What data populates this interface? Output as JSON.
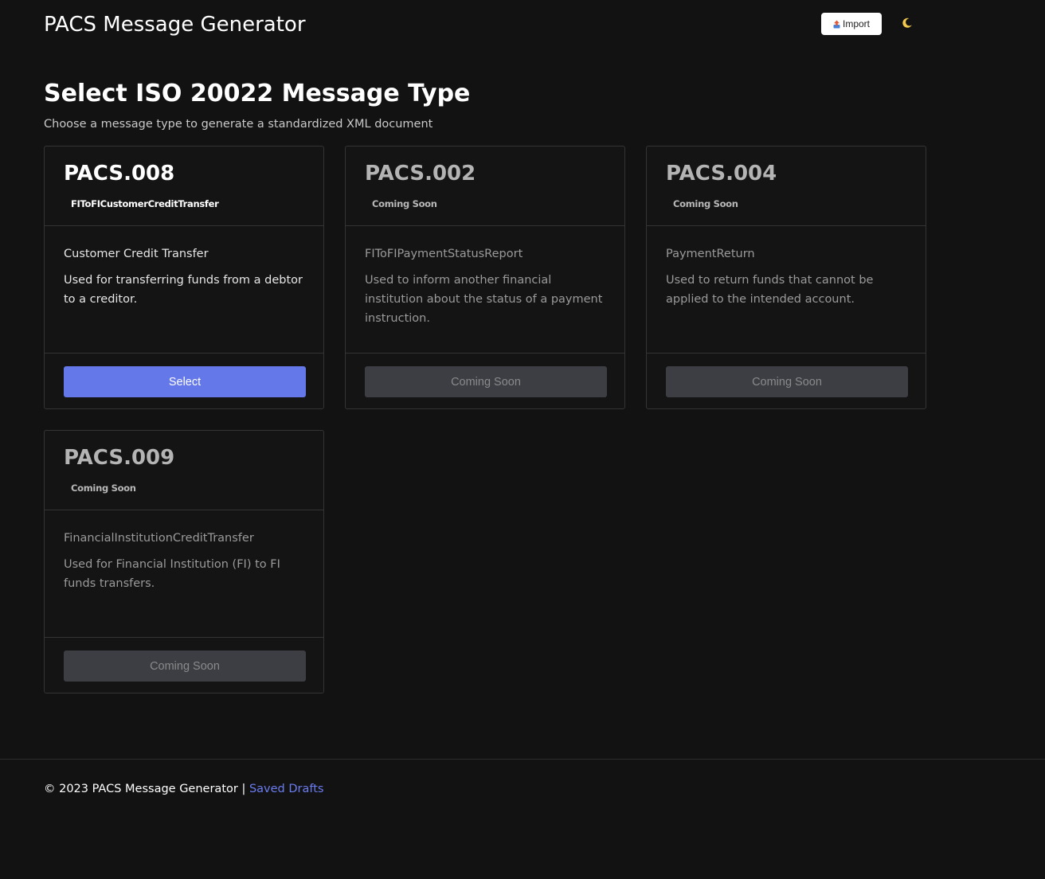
{
  "header": {
    "title": "PACS Message Generator",
    "import_label": "Import",
    "import_icon": "upload-icon",
    "theme_icon": "crescent-moon-icon",
    "theme_icon_color": "#f2c94c"
  },
  "main": {
    "heading": "Select ISO 20022 Message Type",
    "subheading": "Choose a message type to generate a standardized XML document",
    "cards": [
      {
        "code": "PACS.008",
        "badge": "FIToFICustomerCreditTransfer",
        "name": "Customer Credit Transfer",
        "description": "Used for transferring funds from a debtor to a creditor.",
        "button": "Select",
        "enabled": true
      },
      {
        "code": "PACS.002",
        "badge": "Coming Soon",
        "name": "FIToFIPaymentStatusReport",
        "description": "Used to inform another financial institution about the status of a payment instruction.",
        "button": "Coming Soon",
        "enabled": false
      },
      {
        "code": "PACS.004",
        "badge": "Coming Soon",
        "name": "PaymentReturn",
        "description": "Used to return funds that cannot be applied to the intended account.",
        "button": "Coming Soon",
        "enabled": false
      },
      {
        "code": "PACS.009",
        "badge": "Coming Soon",
        "name": "FinancialInstitutionCreditTransfer",
        "description": "Used for Financial Institution (FI) to FI funds transfers.",
        "button": "Coming Soon",
        "enabled": false
      }
    ]
  },
  "footer": {
    "copyright": "© 2023 PACS Message Generator |",
    "link_label": "Saved Drafts"
  },
  "colors": {
    "background": "#121212",
    "accent": "#6478ea",
    "link": "#6b7cf0",
    "disabled_button": "#3c3e44"
  }
}
